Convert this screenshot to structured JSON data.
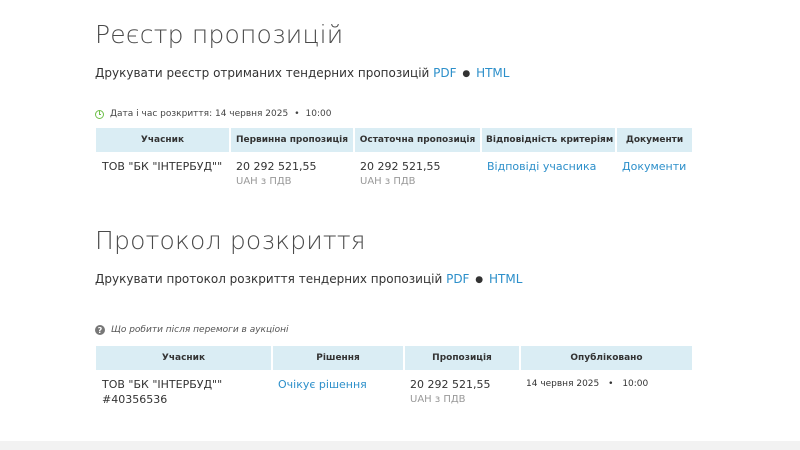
{
  "registry": {
    "title": "Реєстр пропозицій",
    "print_text": "Друкувати реєстр отриманих тендерних пропозицій",
    "pdf_label": "PDF",
    "html_label": "HTML",
    "bullet": "●",
    "open_date_label": "Дата і час розкриття: 14 червня 2025",
    "open_time": "10:00",
    "columns": [
      "Учасник",
      "Первинна пропозиція",
      "Остаточна пропозиція",
      "Відповідність критеріям",
      "Документи"
    ],
    "row": {
      "participant": "ТОВ \"БК \"ІНТЕРБУД\"\"",
      "initial_amount": "20 292 521,55",
      "initial_currency": "UAH з ПДВ",
      "final_amount": "20 292 521,55",
      "final_currency": "UAH з ПДВ",
      "criteria_link": "Відповіді учасника",
      "documents_link": "Документи"
    }
  },
  "protocol": {
    "title": "Протокол розкриття",
    "print_text": "Друкувати протокол розкриття тендерних пропозицій",
    "pdf_label": "PDF",
    "html_label": "HTML",
    "bullet": "●",
    "help_text": "Що робити після перемоги в аукціоні",
    "columns": [
      "Учасник",
      "Рішення",
      "Пропозиція",
      "Опубліковано"
    ],
    "row": {
      "participant": "ТОВ \"БК \"ІНТЕРБУД\"\"",
      "participant_code": "#40356536",
      "decision_link": "Очікує рішення",
      "amount": "20 292 521,55",
      "currency": "UAH з ПДВ",
      "published_date": "14 червня 2025",
      "published_time": "10:00"
    }
  },
  "colors": {
    "link": "#2c8fca",
    "table_header_bg": "#daedf4",
    "clock_green": "#6fbf4a"
  }
}
